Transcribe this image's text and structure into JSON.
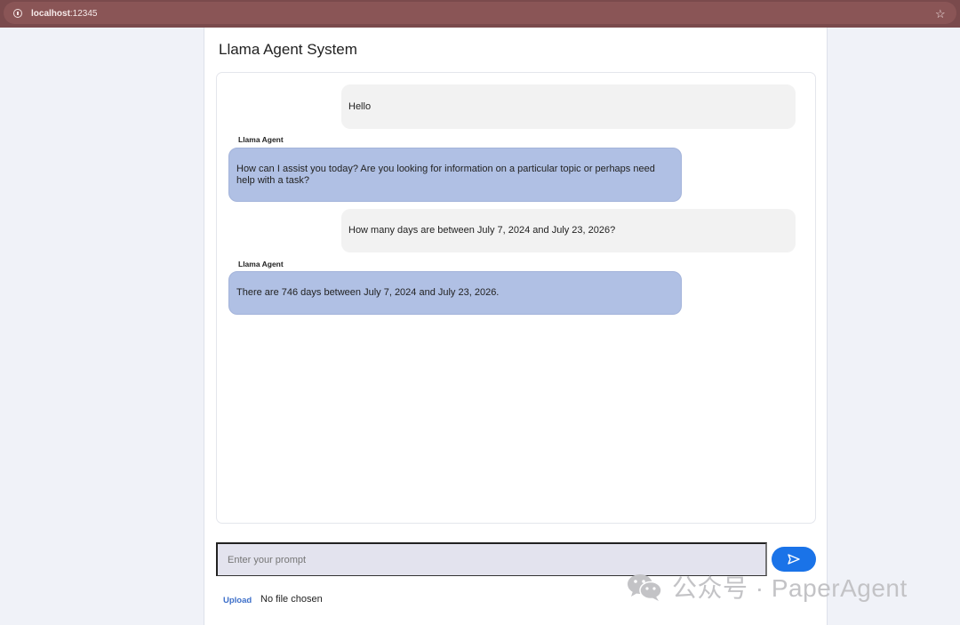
{
  "browser": {
    "url_host": "localhost",
    "url_port": ":12345"
  },
  "app": {
    "title": "Llama Agent System"
  },
  "messages": [
    {
      "role": "user",
      "text": "Hello"
    },
    {
      "role": "agent",
      "sender": "Llama Agent",
      "text": "How can I assist you today? Are you looking for information on a particular topic or perhaps need help with a task?"
    },
    {
      "role": "user",
      "text": "How many days are between July 7, 2024 and July 23, 2026?"
    },
    {
      "role": "agent",
      "sender": "Llama Agent",
      "text": "There are 746 days between July 7, 2024 and July 23, 2026."
    }
  ],
  "input": {
    "placeholder": "Enter your prompt",
    "send_icon": "send-icon"
  },
  "upload": {
    "label": "Upload",
    "status": "No file chosen"
  },
  "watermark": {
    "text": "公众号 · PaperAgent",
    "icon": "wechat-icon"
  },
  "colors": {
    "browser_bar": "#7a4a4c",
    "agent_bubble": "#b0c0e4",
    "user_bubble": "#f2f2f2",
    "send_button": "#1a73e8"
  }
}
